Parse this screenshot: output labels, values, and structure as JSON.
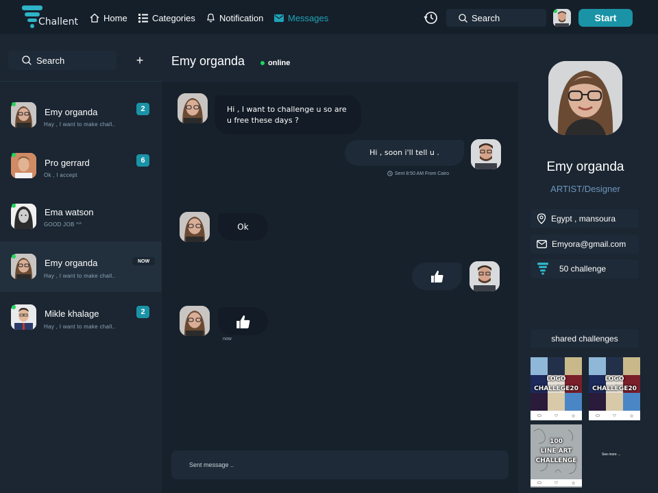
{
  "nav": {
    "logo_text": "Challent",
    "items": [
      {
        "label": "Home",
        "icon": "home-icon"
      },
      {
        "label": "Categories",
        "icon": "list-icon"
      },
      {
        "label": "Notification",
        "icon": "bell-icon"
      },
      {
        "label": "Messages",
        "icon": "mail-icon",
        "active": true
      }
    ],
    "search_label": "Search",
    "start_label": "Start",
    "accent": "#1a93a6"
  },
  "sidebar": {
    "search_label": "Search",
    "add_label": "+",
    "contacts": [
      {
        "name": "Emy organda",
        "preview": "Hay , I want to make chall..",
        "badge": "2",
        "online": true
      },
      {
        "name": "Pro gerrard",
        "preview": "Ok , I accept",
        "badge": "6",
        "online": true
      },
      {
        "name": "Ema watson",
        "preview": "GOOD JOB ^^",
        "badge": "",
        "online": true
      },
      {
        "name": "Emy organda",
        "preview": "Hay , I want to make chall..",
        "badge": "NOW",
        "online": true,
        "selected": true
      },
      {
        "name": "Mikle khalage",
        "preview": "Hay , I want to make chall..",
        "badge": "2",
        "online": true
      }
    ]
  },
  "chat": {
    "contact_name": "Emy organda",
    "status": "online",
    "messages": [
      {
        "from": "them",
        "text_line1": "Hi , I want to challenge u so are",
        "text_line2": "u free these days ?"
      },
      {
        "from": "me",
        "text": "Hi , soon i'll tell u ."
      },
      {
        "from": "them",
        "text": "Ok"
      },
      {
        "from": "me",
        "text": "",
        "icon": "thumbs-up-icon"
      },
      {
        "from": "them",
        "text": "",
        "icon": "thumbs-up-icon"
      }
    ],
    "sent_info": "Sent 8:50 AM From Cairo",
    "now_label": "now",
    "input_placeholder": "Sent message .."
  },
  "profile": {
    "name": "Emy organda",
    "role": "ARTIST/Designer",
    "location": "Egypt , mansoura",
    "email": "Emyora@gmail.com",
    "challenges": "50 challenge",
    "shared_title": "shared challenges",
    "thumbs": [
      {
        "title_line1": "LOGO",
        "title_line2": "CHALLEGE20"
      },
      {
        "title_line1": "LOGO",
        "title_line2": "CHALLEGE20"
      },
      {
        "title_line1": "100",
        "title_line2": "LINE ART",
        "title_line3": "CHALLENGE"
      }
    ],
    "see_more": "See more ..."
  }
}
